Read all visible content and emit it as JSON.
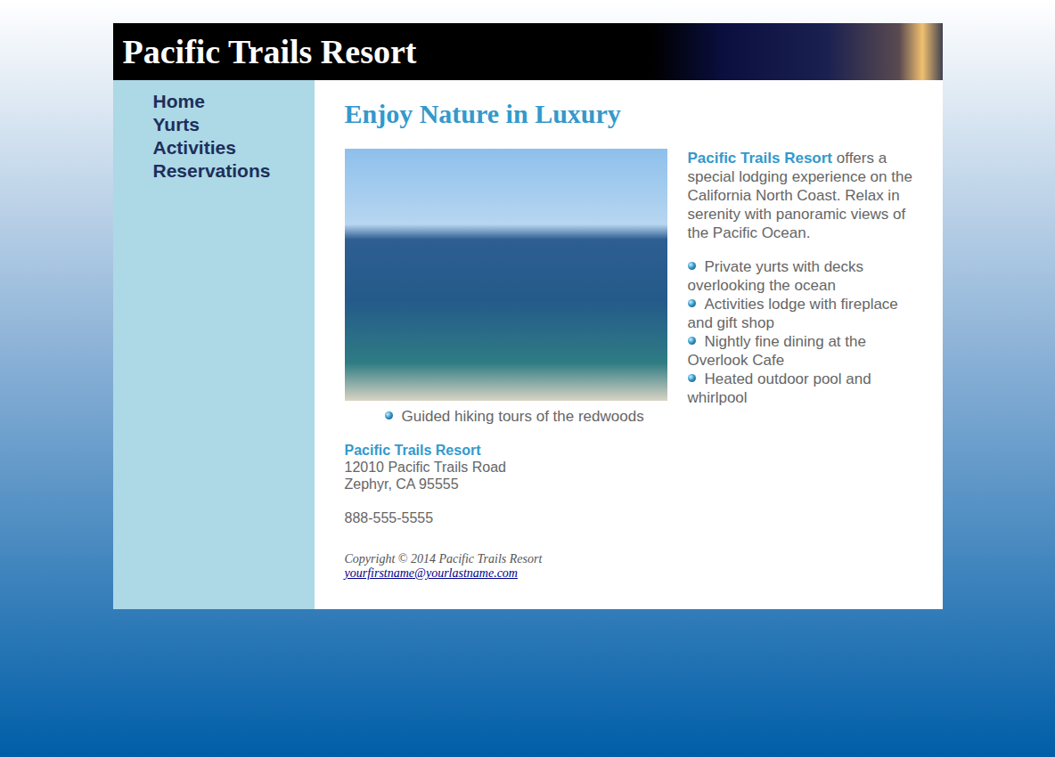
{
  "header": {
    "title": "Pacific Trails Resort"
  },
  "nav": {
    "items": [
      {
        "label": "Home"
      },
      {
        "label": "Yurts"
      },
      {
        "label": "Activities"
      },
      {
        "label": "Reservations"
      }
    ]
  },
  "main": {
    "heading": "Enjoy Nature in Luxury",
    "intro": {
      "brand": "Pacific Trails Resort",
      "text": "offers a special lodging experience on the California North Coast. Relax in serenity with panoramic views of the Pacific Ocean."
    },
    "features": [
      "Private yurts with decks overlooking the ocean",
      "Activities lodge with fireplace and gift shop",
      "Nightly fine dining at the Overlook Cafe",
      "Heated outdoor pool and whirlpool",
      "Guided hiking tours of the redwoods"
    ],
    "contact": {
      "name": "Pacific Trails Resort",
      "address": [
        "12010 Pacific Trails Road",
        "Zephyr, CA 95555"
      ],
      "phone": "888-555-5555"
    }
  },
  "footer": {
    "copyright": "Copyright © 2014 Pacific Trails Resort",
    "email": "yourfirstname@yourlastname.com"
  }
}
